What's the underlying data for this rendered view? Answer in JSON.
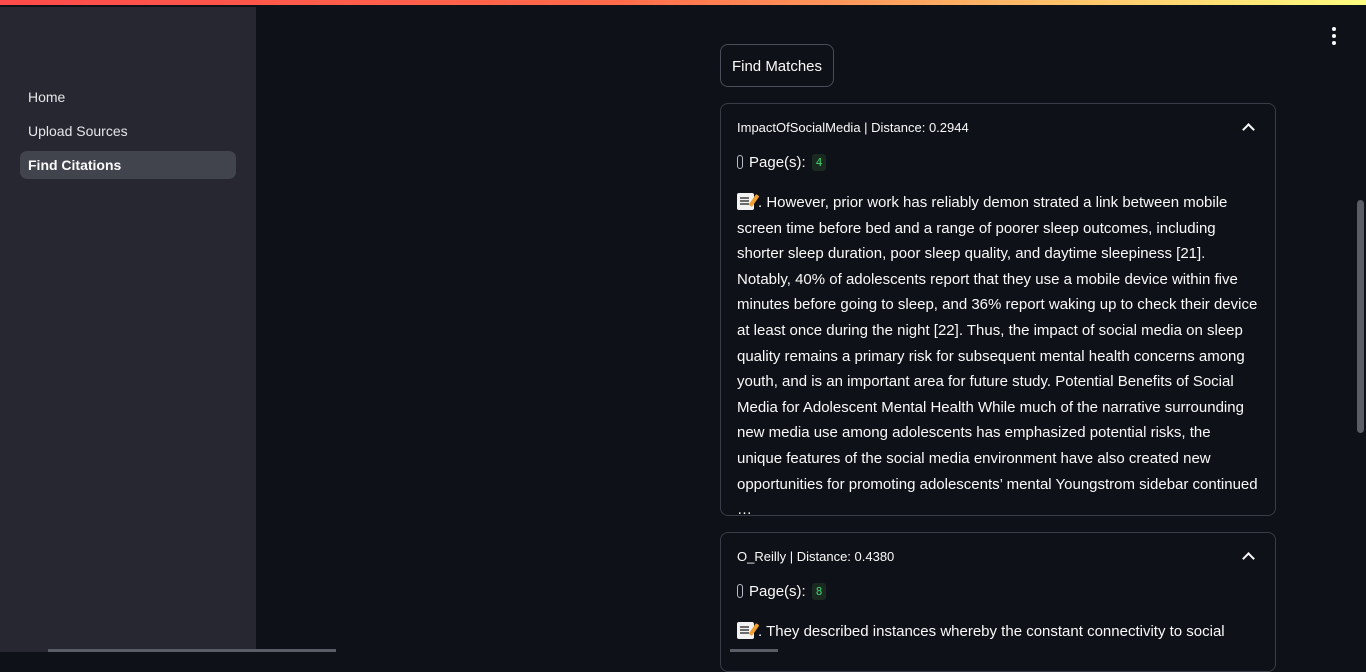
{
  "sidebar": {
    "items": [
      {
        "label": "Home"
      },
      {
        "label": "Upload Sources"
      },
      {
        "label": "Find Citations"
      }
    ]
  },
  "main": {
    "find_button_label": "Find Matches",
    "results": [
      {
        "header": "ImpactOfSocialMedia | Distance: 0.2944",
        "pages_label": "Page(s):",
        "pages_value": "4",
        "excerpt": ". However, prior work has reliably demon strated a link between mobile screen time before bed and a range of poorer sleep outcomes, including shorter sleep duration, poor sleep quality, and daytime sleepiness [21]. Notably, 40% of adolescents report that they use a mobile device within five minutes before going to sleep, and 36% report waking up to check their device at least once during the night [22]. Thus, the impact of social media on sleep quality remains a primary risk for subsequent mental health concerns among youth, and is an important area for future study. Potential Benefits of Social Media for Adolescent Mental Health While much of the narrative surrounding new media use among adolescents has emphasized potential risks, the unique features of the social media environment have also created new opportunities for promoting adolescents’ mental Youngstrom sidebar continued …"
      },
      {
        "header": "O_Reilly | Distance: 0.4380",
        "pages_label": "Page(s):",
        "pages_value": "8",
        "excerpt": ". They described instances whereby the constant connectivity to social"
      }
    ]
  },
  "icons": {
    "menu": "vertical-ellipsis-icon",
    "clip": "paperclip-icon",
    "memo": "memo-icon",
    "chevron": "chevron-up-icon"
  },
  "colors": {
    "background": "#0e1117",
    "sidebar": "#262730",
    "accent_green": "#3dd56d"
  }
}
